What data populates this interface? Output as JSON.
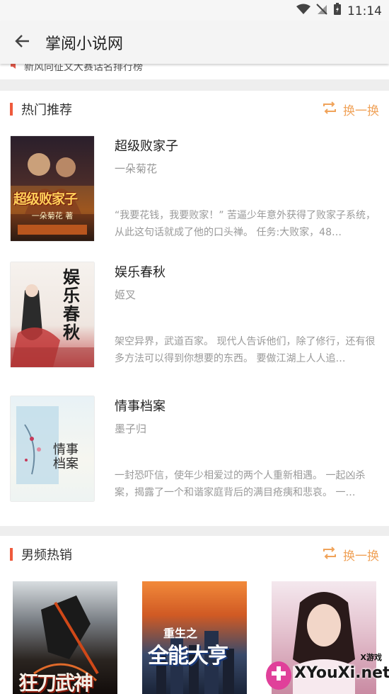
{
  "status": {
    "time": "11:14"
  },
  "appbar": {
    "title": "掌阅小说网"
  },
  "notice": {
    "text": "新风向征文大赛话名排行榜"
  },
  "hot": {
    "title": "热门推荐",
    "swap_label": "换一换",
    "books": [
      {
        "title": "超级败家子",
        "author": "一朵菊花",
        "desc": "“我要花钱，我要败家！” 苦逼少年意外获得了败家子系统，从此这句话就成了他的口头禅。 任务:大败家，48…",
        "cover_text": "超级败家子",
        "cover_sub": "一朵菊花 著"
      },
      {
        "title": "娱乐春秋",
        "author": "姬叉",
        "desc": "架空异界，武道百家。 现代人告诉他们，除了修行，还有很多方法可以得到你想要的东西。 要做江湖上人人追…",
        "cover_text": "娱乐春秋"
      },
      {
        "title": "情事档案",
        "author": "墨子归",
        "desc": "一封恐吓信，使年少相爱过的两个人重新相遇。 一起凶杀案，揭露了一个和谐家庭背后的满目疮痍和悲哀。 一…",
        "cover_text": "情事档案"
      }
    ]
  },
  "male": {
    "title": "男频热销",
    "swap_label": "换一换",
    "covers": [
      {
        "text": "狂刀武神"
      },
      {
        "text": "全能大亨",
        "sub": "重生之"
      },
      {
        "text": ""
      }
    ]
  },
  "watermark": {
    "brand": "XYouXi.net",
    "tag": "X游戏"
  }
}
